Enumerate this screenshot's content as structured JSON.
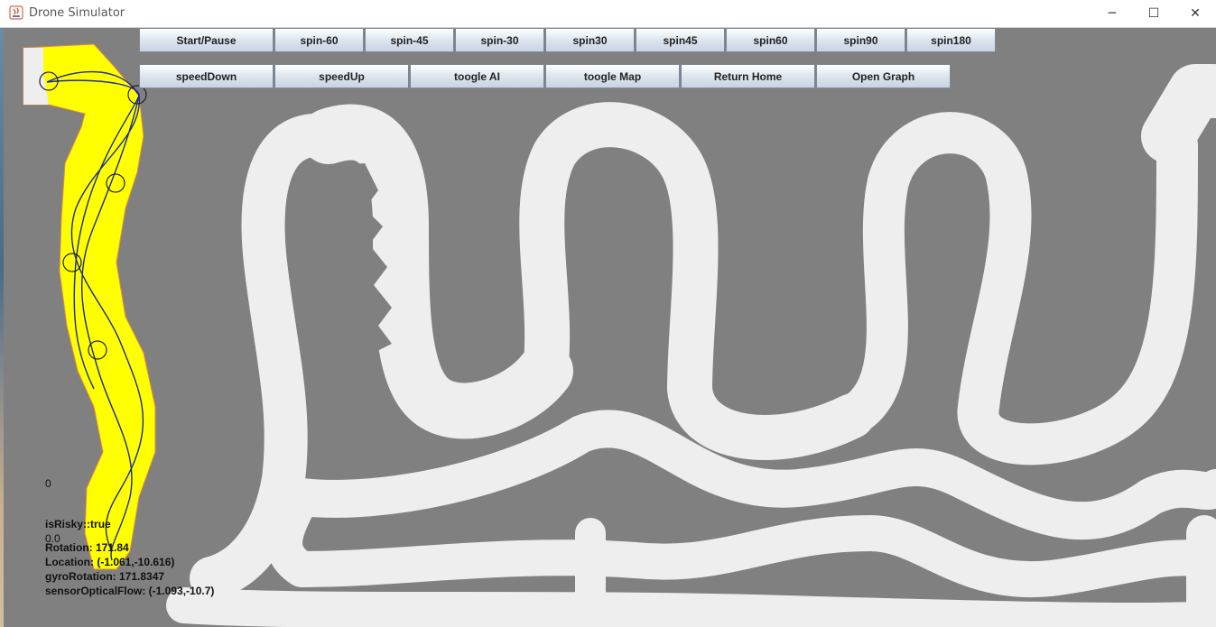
{
  "window": {
    "title": "Drone Simulator",
    "minimize": "─",
    "maximize": "☐",
    "close": "✕"
  },
  "toolbar_row1": [
    "Start/Pause",
    "spin-60",
    "spin-45",
    "spin-30",
    "spin30",
    "spin45",
    "spin60",
    "spin90",
    "spin180"
  ],
  "toolbar_row2": [
    "speedDown",
    "speedUp",
    "toogle AI",
    "toogle Map",
    "Return Home",
    "Open Graph"
  ],
  "info": {
    "counter": "0",
    "is_risky": "isRisky::true",
    "value": "0.0",
    "rotation": "Rotation: 171.84",
    "location": "Location: (-1.061,-10.616)",
    "gyro_rotation": "gyroRotation: 171.8347",
    "sensor_optical_flow": "sensorOpticalFlow: (-1.093,-10.7)"
  },
  "colors": {
    "wall": "#808080",
    "path": "#eeeeee",
    "explored": "#ffff00",
    "drone_path": "#1a2a9a"
  }
}
